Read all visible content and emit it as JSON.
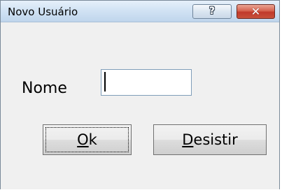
{
  "window": {
    "title": "Novo Usuário",
    "help_glyph": "?",
    "close_glyph": "✕"
  },
  "form": {
    "name_label": "Nome",
    "name_value": ""
  },
  "buttons": {
    "ok": {
      "mnemonic": "O",
      "rest": "k"
    },
    "cancel": {
      "mnemonic": "D",
      "rest": "esistir"
    }
  },
  "colors": {
    "titlebar": "#d2e3f4",
    "close_button": "#c0392b",
    "window_face": "#f0f0f0"
  },
  "icons": {
    "help": "help-icon",
    "close": "close-icon"
  }
}
